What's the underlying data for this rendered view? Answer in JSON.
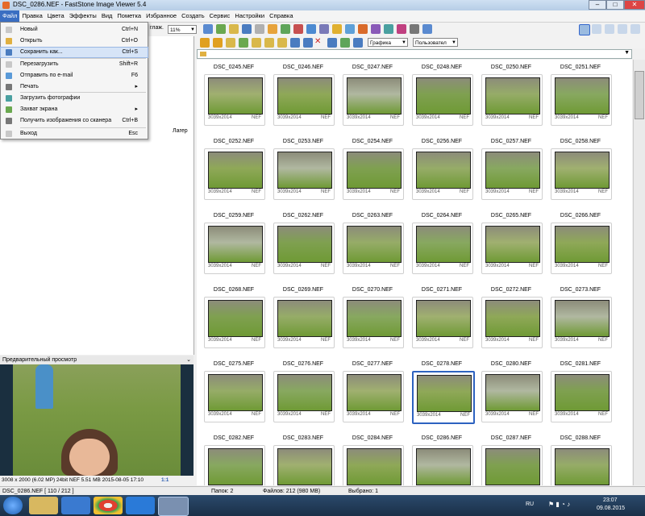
{
  "window": {
    "title": "DSC_0286.NEF - FastStone Image Viewer 5.4"
  },
  "menubar": [
    "Файл",
    "Правка",
    "Цвета",
    "Эффекты",
    "Вид",
    "Пометка",
    "Избранное",
    "Создать",
    "Сервис",
    "Настройки",
    "Справка"
  ],
  "file_menu": [
    {
      "label": "Новый",
      "shortcut": "Ctrl+N"
    },
    {
      "label": "Открыть",
      "shortcut": "Ctrl+O"
    },
    {
      "label": "Сохранить как...",
      "shortcut": "Ctrl+S"
    },
    {
      "label": "Перезагрузить",
      "shortcut": "Shift+R"
    },
    {
      "label": "Отправить по e-mail",
      "shortcut": "F6"
    },
    {
      "label": "Печать",
      "shortcut": "▸"
    },
    {
      "label": "Загрузить фотографии",
      "shortcut": ""
    },
    {
      "label": "Захват экрана",
      "shortcut": "▸"
    },
    {
      "label": "Получить изображения со сканера",
      "shortcut": "Ctrl+B"
    },
    {
      "label": "Выход",
      "shortcut": "Esc"
    }
  ],
  "toolbar": {
    "fit_label": "глаж.",
    "zoom": "11%",
    "filter": "Графика",
    "sort": "Пользовател"
  },
  "tree": {
    "partial_label": "Лагер"
  },
  "preview": {
    "header": "Предварительный просмотр",
    "info": "3008 x 2000 (6.02 MP)  24bit  NEF  5.51 MB  2015-08-05 17:10",
    "ratio": "1:1"
  },
  "thumbnails": {
    "rows": [
      [
        "DSC_0245.NEF",
        "DSC_0246.NEF",
        "DSC_0247.NEF",
        "DSC_0248.NEF",
        "DSC_0250.NEF",
        "DSC_0251.NEF"
      ],
      [
        "DSC_0252.NEF",
        "DSC_0253.NEF",
        "DSC_0254.NEF",
        "DSC_0256.NEF",
        "DSC_0257.NEF",
        "DSC_0258.NEF"
      ],
      [
        "DSC_0259.NEF",
        "DSC_0262.NEF",
        "DSC_0263.NEF",
        "DSC_0264.NEF",
        "DSC_0265.NEF",
        "DSC_0266.NEF"
      ],
      [
        "DSC_0268.NEF",
        "DSC_0269.NEF",
        "DSC_0270.NEF",
        "DSC_0271.NEF",
        "DSC_0272.NEF",
        "DSC_0273.NEF"
      ],
      [
        "DSC_0275.NEF",
        "DSC_0276.NEF",
        "DSC_0277.NEF",
        "DSC_0278.NEF",
        "DSC_0280.NEF",
        "DSC_0281.NEF"
      ],
      [
        "DSC_0282.NEF",
        "DSC_0283.NEF",
        "DSC_0284.NEF",
        "DSC_0286.NEF",
        "DSC_0287.NEF",
        "DSC_0288.NEF"
      ]
    ],
    "resolution": "3039x2014",
    "ext": "NEF",
    "selected": "DSC_0278.NEF"
  },
  "status": {
    "file": "DSC_0286.NEF [ 110 / 212 ]",
    "folders": "Папок: 2",
    "files": "Файлов: 212 (980 MB)",
    "selected": "Выбрано: 1"
  },
  "taskbar": {
    "lang": "RU",
    "time": "23:07",
    "date": "09.08.2015"
  }
}
